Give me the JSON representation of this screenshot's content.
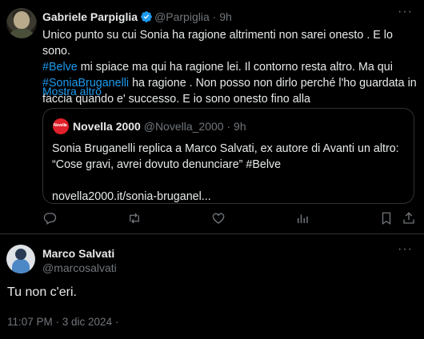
{
  "tweet": {
    "author_name": "Gabriele Parpiglia",
    "author_handle": "@Parpiglia",
    "dot": "·",
    "time": "9h",
    "more": "···",
    "body": {
      "l1": "Unico punto su cui Sonia ha ragione altrimenti non sarei onesto . E lo sono.",
      "l2_tag": "#Belve",
      "l2": " mi spiace ma qui ha ragione lei. Il contorno resta altro. Ma qui",
      "l3_tag": "#SoniaBruganelli",
      "l3": " ha ragione . Non posso non dirlo perché l'ho guardata in",
      "l4": "faccia quando e' successo. E io sono onesto fino alla"
    },
    "show_more": "Mostra altro",
    "quote": {
      "avatar_text": "Novella",
      "author_name": "Novella 2000",
      "author_handle": "@Novella_2000",
      "dot": "·",
      "time": "9h",
      "line1": "Sonia Bruganelli replica a Marco Salvati, ex autore di Avanti un altro:",
      "line2": "“Cose gravi, avrei dovuto denunciare” #Belve",
      "link": "novella2000.it/sonia-bruganel..."
    }
  },
  "reply_tweet": {
    "author_name": "Marco Salvati",
    "author_handle": "@marcosalvati",
    "more": "···",
    "text": "Tu non c'eri.",
    "meta": "11:07 PM · 3 dic 2024 ·"
  },
  "colors": {
    "accent": "#1d9bf0",
    "muted": "#71767b",
    "border": "#2f3336",
    "text": "#e7e9ea"
  },
  "icons": [
    "verified-badge-icon",
    "reply-icon",
    "retweet-icon",
    "like-icon",
    "views-icon",
    "bookmark-icon",
    "share-icon"
  ]
}
